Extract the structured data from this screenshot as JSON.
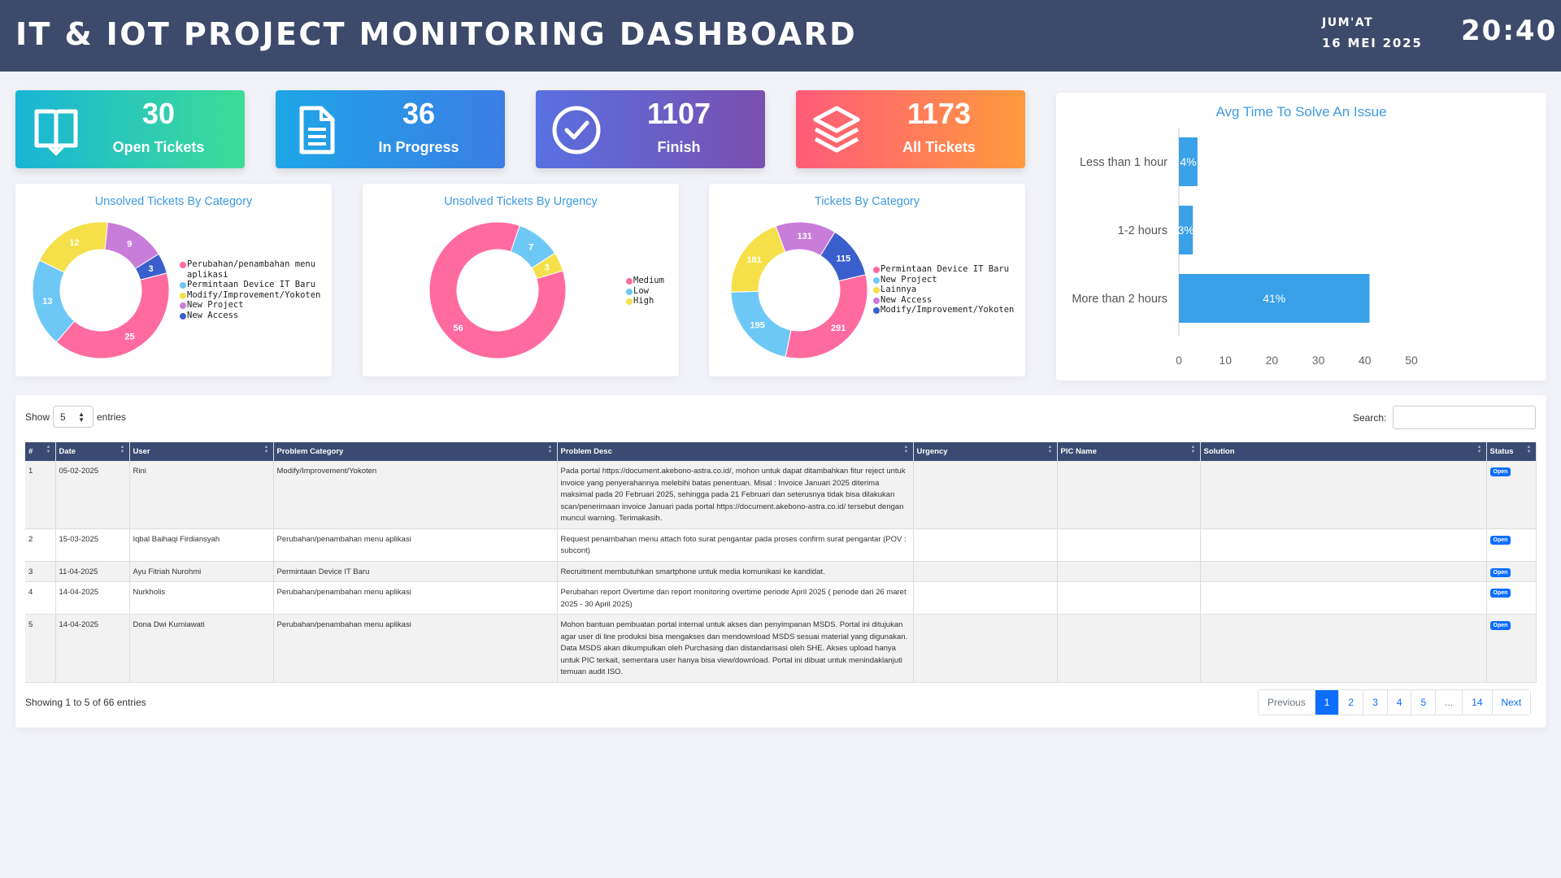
{
  "header": {
    "title": "IT & IOT PROJECT MONITORING DASHBOARD",
    "day": "JUM'AT",
    "date": "16 MEI 2025",
    "time": "20:40"
  },
  "stats": [
    {
      "value": "30",
      "label": "Open Tickets",
      "icon": "book-open-icon"
    },
    {
      "value": "36",
      "label": "In Progress",
      "icon": "document-icon"
    },
    {
      "value": "1107",
      "label": "Finish",
      "icon": "check-circle-icon"
    },
    {
      "value": "1173",
      "label": "All Tickets",
      "icon": "layers-icon"
    }
  ],
  "charts": {
    "unsolved_category_title": "Unsolved Tickets By Category",
    "unsolved_urgency_title": "Unsolved Tickets By Urgency",
    "tickets_category_title": "Tickets By Category",
    "avg_time_title": "Avg Time To Solve An Issue"
  },
  "chart_data": [
    {
      "type": "pie",
      "title": "Unsolved Tickets By Category",
      "categories": [
        "Perubahan/penambahan menu aplikasi",
        "Permintaan Device IT Baru",
        "Modify/Improvement/Yokoten",
        "New Project",
        "New Access"
      ],
      "values": [
        25,
        13,
        12,
        9,
        3
      ],
      "colors": [
        "#ff6b9f",
        "#6ec8f5",
        "#f5e04a",
        "#c97ddb",
        "#3a5fcd"
      ]
    },
    {
      "type": "pie",
      "title": "Unsolved Tickets By Urgency",
      "categories": [
        "Medium",
        "Low",
        "High"
      ],
      "values": [
        56,
        7,
        3
      ],
      "colors": [
        "#ff6b9f",
        "#6ec8f5",
        "#f5e04a"
      ]
    },
    {
      "type": "pie",
      "title": "Tickets By Category",
      "categories": [
        "Permintaan Device IT Baru",
        "New Project",
        "Lainnya",
        "New Access",
        "Modify/Improvement/Yokoten"
      ],
      "values": [
        291,
        195,
        181,
        131,
        115
      ],
      "colors": [
        "#ff6b9f",
        "#6ec8f5",
        "#f5e04a",
        "#c97ddb",
        "#3a5fcd"
      ]
    },
    {
      "type": "bar",
      "orientation": "horizontal",
      "title": "Avg Time To Solve An Issue",
      "categories": [
        "Less than 1 hour",
        "1-2 hours",
        "More than 2 hours"
      ],
      "values": [
        4,
        3,
        41
      ],
      "labels": [
        "4%",
        "3%",
        "41%"
      ],
      "xlim": [
        0,
        50
      ],
      "xticks": [
        0,
        10,
        20,
        30,
        40,
        50
      ],
      "color": "#3aa1e8"
    }
  ],
  "table": {
    "show_label": "Show",
    "page_size": "5",
    "entries_label": "entries",
    "search_label": "Search:",
    "search_value": "",
    "columns": [
      "#",
      "Date",
      "User",
      "Problem Category",
      "Problem Desc",
      "Urgency",
      "PIC Name",
      "Solution",
      "Status"
    ],
    "rows": [
      {
        "no": "1",
        "date": "05-02-2025",
        "user": "Rini",
        "category": "Modify/Improvement/Yokoten",
        "desc": "Pada portal https://document.akebono-astra.co.id/, mohon untuk dapat ditambahkan fitur reject untuk invoice yang penyerahannya melebihi batas penentuan. Misal : Invoice Januari 2025 diterima maksimal pada 20 Februari 2025, sehingga pada 21 Februari dan seterusnya tidak bisa dilakukan scan/penerimaan invoice Januari pada portal https://document.akebono-astra.co.id/ tersebut dengan muncul warning. Terimakasih.",
        "urgency": "",
        "pic": "",
        "solution": "",
        "status": "Open"
      },
      {
        "no": "2",
        "date": "15-03-2025",
        "user": "Iqbal Baihaqi Firdiansyah",
        "category": "Perubahan/penambahan menu aplikasi",
        "desc": "Request penambahan menu attach foto surat pengantar pada proses confirm surat pengantar (POV : subcont)",
        "urgency": "",
        "pic": "",
        "solution": "",
        "status": "Open"
      },
      {
        "no": "3",
        "date": "11-04-2025",
        "user": "Ayu Fitriah Nurohmi",
        "category": "Permintaan Device IT Baru",
        "desc": "Recruitment membutuhkan smartphone untuk media komunikasi ke kandidat.",
        "urgency": "",
        "pic": "",
        "solution": "",
        "status": "Open"
      },
      {
        "no": "4",
        "date": "14-04-2025",
        "user": "Nurkholis",
        "category": "Perubahan/penambahan menu aplikasi",
        "desc": "Perubahan report Overtime dan report monitoring overtime periode April 2025 ( periode dari 26 maret 2025 - 30 April 2025)",
        "urgency": "",
        "pic": "",
        "solution": "",
        "status": "Open"
      },
      {
        "no": "5",
        "date": "14-04-2025",
        "user": "Dona Dwi Kurniawati",
        "category": "Perubahan/penambahan menu aplikasi",
        "desc": "Mohon bantuan pembuatan portal internal untuk akses dan penyimpanan MSDS. Portal ini ditujukan agar user di line produksi bisa mengakses dan mendownload MSDS sesuai material yang digunakan. Data MSDS akan dikumpulkan oleh Purchasing dan distandarisasi oleh SHE. Akses upload hanya untuk PIC terkait, sementara user hanya bisa view/download. Portal ini dibuat untuk menindaklanjuti temuan audit ISO.",
        "urgency": "",
        "pic": "",
        "solution": "",
        "status": "Open"
      }
    ],
    "info": "Showing 1 to 5 of 66 entries",
    "pagination": [
      "Previous",
      "1",
      "2",
      "3",
      "4",
      "5",
      "...",
      "14",
      "Next"
    ],
    "active_page": "1"
  },
  "colors": {
    "header_bg": "#3d4a6b",
    "accent": "#3d9ae0",
    "table_header": "#3a4a72",
    "badge": "#0d6efd"
  }
}
